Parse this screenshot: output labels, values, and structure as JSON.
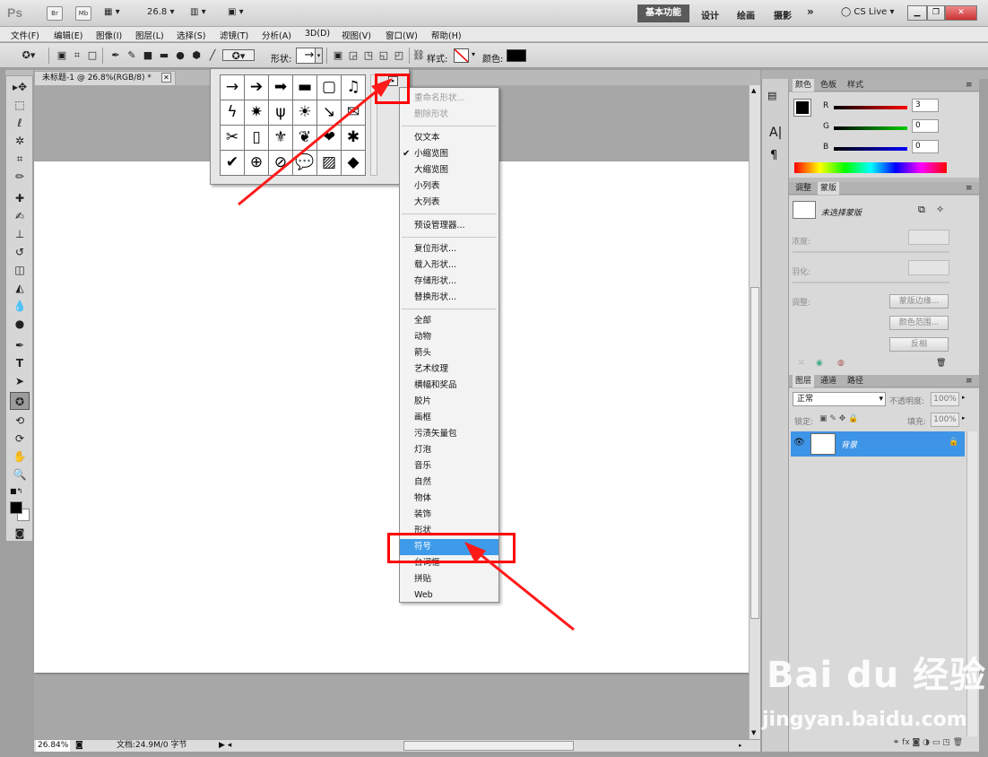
{
  "titlebar": {
    "logo": "Ps",
    "br": "Br",
    "mb": "Mb",
    "zoom": "26.8",
    "workspace_active": "基本功能",
    "workspaces": [
      "设计",
      "绘画",
      "摄影"
    ],
    "more": "»",
    "cslive": "CS Live"
  },
  "menubar": [
    "文件(F)",
    "编辑(E)",
    "图像(I)",
    "图层(L)",
    "选择(S)",
    "滤镜(T)",
    "分析(A)",
    "3D(D)",
    "视图(V)",
    "窗口(W)",
    "帮助(H)"
  ],
  "options": {
    "shape_label": "形状:",
    "style_label": "样式:",
    "color_label": "颜色:",
    "color_value": "#000000"
  },
  "document": {
    "tab_title": "未标题-1 @ 26.8%(RGB/8) *",
    "zoom": "26.84%",
    "doc_info": "文档:24.9M/0 字节"
  },
  "shape_picker": {
    "cells": [
      "→",
      "➔",
      "➡",
      "▬",
      "▢",
      "♫",
      "ϟ",
      "✷",
      "ψ",
      "☀",
      "↘",
      "✉",
      "✂",
      "▯",
      "⚜",
      "❦",
      "❤",
      "✱",
      "✔",
      "⊕",
      "⊘",
      "💬",
      "▨",
      "◆"
    ]
  },
  "flyout": {
    "items": [
      {
        "label": "重命名形状...",
        "disabled": true
      },
      {
        "label": "删除形状",
        "disabled": true
      },
      {
        "sep": true
      },
      {
        "label": "仅文本"
      },
      {
        "label": "小缩览图",
        "checked": true
      },
      {
        "label": "大缩览图"
      },
      {
        "label": "小列表"
      },
      {
        "label": "大列表"
      },
      {
        "sep": true
      },
      {
        "label": "预设管理器..."
      },
      {
        "sep": true
      },
      {
        "label": "复位形状..."
      },
      {
        "label": "载入形状..."
      },
      {
        "label": "存储形状..."
      },
      {
        "label": "替换形状..."
      },
      {
        "sep": true
      },
      {
        "label": "全部"
      },
      {
        "label": "动物"
      },
      {
        "label": "箭头"
      },
      {
        "label": "艺术纹理"
      },
      {
        "label": "横幅和奖品"
      },
      {
        "label": "胶片"
      },
      {
        "label": "画框"
      },
      {
        "label": "污渍矢量包"
      },
      {
        "label": "灯泡"
      },
      {
        "label": "音乐"
      },
      {
        "label": "自然"
      },
      {
        "label": "物体"
      },
      {
        "label": "装饰"
      },
      {
        "label": "形状"
      },
      {
        "label": "符号",
        "selected": true
      },
      {
        "label": "台词框"
      },
      {
        "label": "拼贴"
      },
      {
        "label": "Web"
      }
    ]
  },
  "color_panel": {
    "tabs": [
      "颜色",
      "色板",
      "样式"
    ],
    "r_label": "R",
    "g_label": "G",
    "b_label": "B",
    "r": "3",
    "g": "0",
    "b": "0"
  },
  "masks_panel": {
    "tabs": [
      "调整",
      "蒙版"
    ],
    "no_mask": "未选择蒙版",
    "density": "浓度:",
    "feather": "羽化:",
    "refine": "调整:",
    "edge_btn": "蒙版边缘...",
    "range_btn": "颜色范围...",
    "invert_btn": "反相"
  },
  "layers_panel": {
    "tabs": [
      "图层",
      "通道",
      "路径"
    ],
    "blend": "正常",
    "opacity_label": "不透明度:",
    "opacity": "100%",
    "lock_label": "锁定:",
    "fill_label": "填充:",
    "fill": "100%",
    "layer_name": "背景"
  },
  "watermark": {
    "line1": "Bai du 经验",
    "line2": "jingyan.baidu.com"
  }
}
